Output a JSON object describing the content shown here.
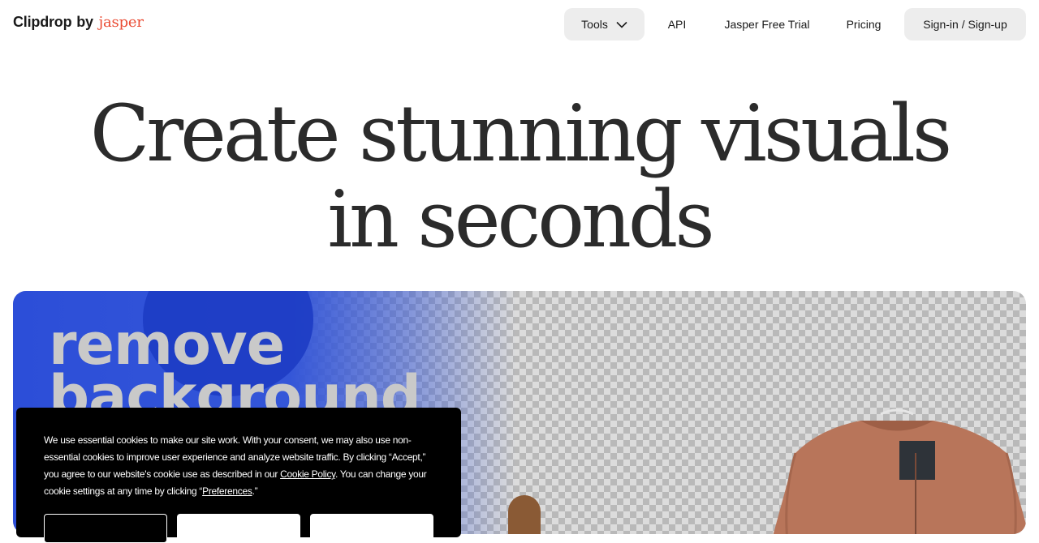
{
  "header": {
    "logo_main": "Clipdrop",
    "logo_by": "by",
    "logo_brand": "jasper",
    "nav": {
      "tools": "Tools",
      "api": "API",
      "trial": "Jasper Free Trial",
      "pricing": "Pricing",
      "signin": "Sign-in / Sign-up"
    }
  },
  "hero": {
    "title_line1": "Create stunning visuals",
    "title_line2": "in seconds"
  },
  "demo": {
    "text_line1": "remove",
    "text_line2": "background"
  },
  "cookie": {
    "text_before_link": "We use essential cookies to make our site work. With your consent, we may also use non-essential cookies to improve user experience and analyze website traffic. By clicking “Accept,” you agree to our website's cookie use as described in our ",
    "policy_link": "Cookie Policy",
    "text_middle": ". You can change your cookie settings at any time by clicking “",
    "preferences_link": "Preferences",
    "text_end": ".”"
  },
  "colors": {
    "brand_red": "#ea4b33",
    "demo_blue": "#3456d8",
    "nav_button_bg": "#ededed"
  }
}
